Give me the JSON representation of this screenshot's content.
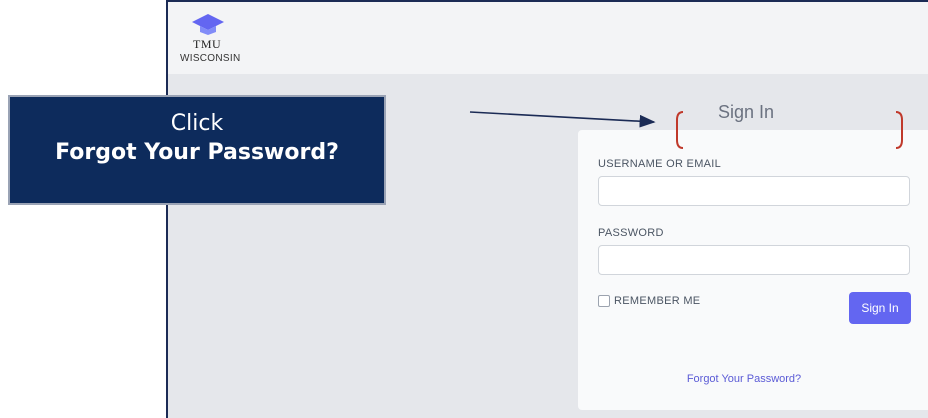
{
  "callout": {
    "line1": "Click",
    "line2": "Forgot Your Password?"
  },
  "app": {
    "logo": {
      "abbr": "TMU",
      "name": "WISCONSIN",
      "icon": "graduation-cap-icon",
      "icon_color": "#6366f1"
    },
    "title": "Sign In",
    "form": {
      "username_label": "USERNAME OR EMAIL",
      "username_value": "",
      "password_label": "PASSWORD",
      "password_value": "",
      "remember_label": "REMEMBER ME",
      "submit_label": "Sign In",
      "forgot_label": "Forgot Your Password?"
    }
  },
  "colors": {
    "callout_bg": "#0d2b5c",
    "accent": "#6366f1",
    "annotation_bracket": "#c0392b",
    "annotation_arrow": "#1b2b55"
  }
}
